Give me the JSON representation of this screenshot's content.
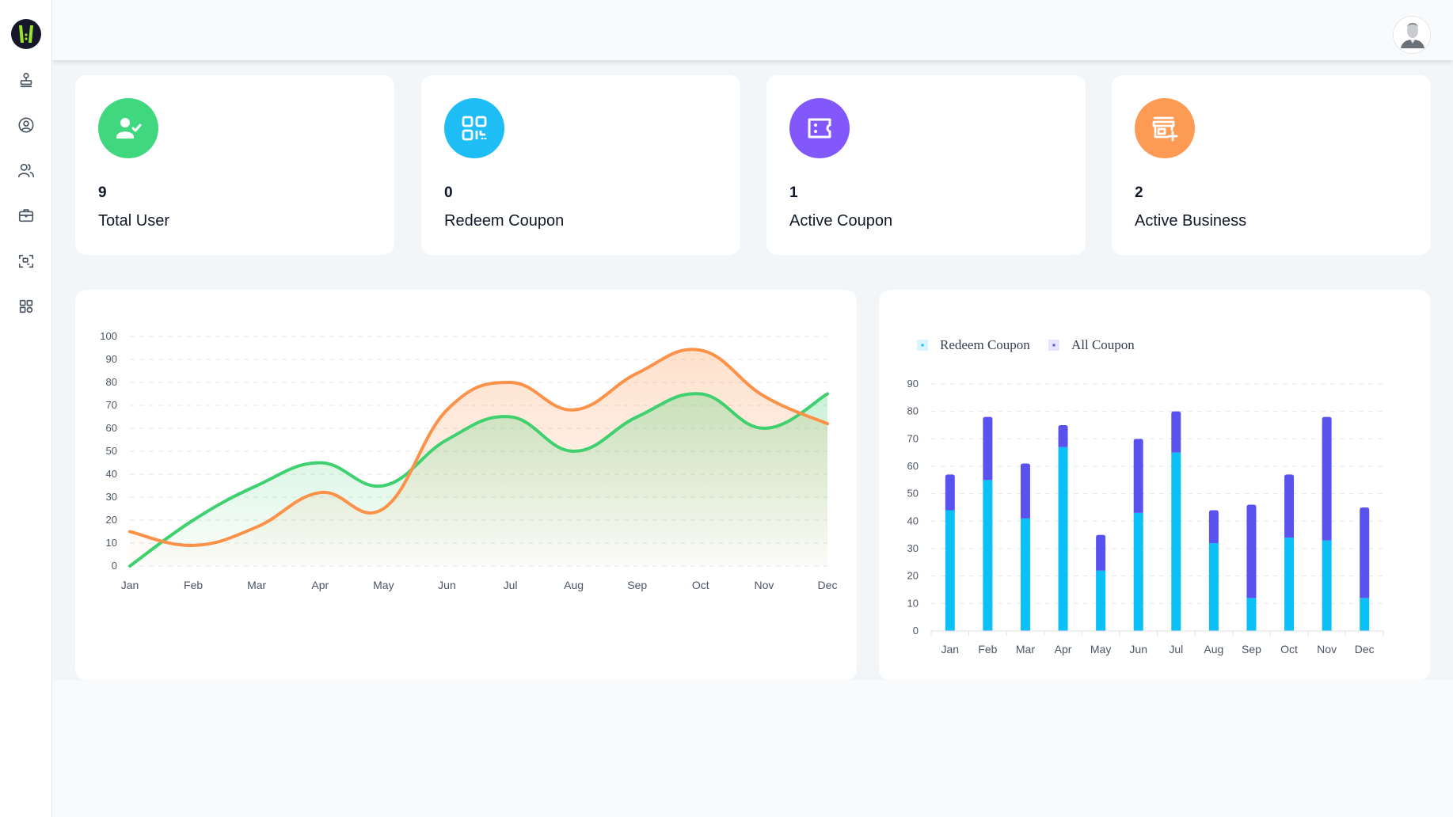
{
  "sidebar": {
    "logo": "app-logo",
    "items": [
      {
        "name": "stamp",
        "icon": "stamp-icon"
      },
      {
        "name": "profile",
        "icon": "user-circle-icon"
      },
      {
        "name": "users",
        "icon": "users-icon"
      },
      {
        "name": "business",
        "icon": "briefcase-icon"
      },
      {
        "name": "scan",
        "icon": "scan-icon"
      },
      {
        "name": "dashboard",
        "icon": "grid-icon"
      }
    ]
  },
  "header": {
    "avatar": "user-avatar"
  },
  "stats": [
    {
      "value": "9",
      "label": "Total User",
      "icon": "user-check-icon",
      "color": "#3fd87f"
    },
    {
      "value": "0",
      "label": "Redeem Coupon",
      "icon": "qr-code-icon",
      "color": "#1fbdf6"
    },
    {
      "value": "1",
      "label": "Active Coupon",
      "icon": "ticket-icon",
      "color": "#8257fb"
    },
    {
      "value": "2",
      "label": "Active Business",
      "icon": "store-add-icon",
      "color": "#fd9a53"
    }
  ],
  "chart_data": [
    {
      "type": "area",
      "title": "",
      "xlabel": "",
      "ylabel": "",
      "categories": [
        "Jan",
        "Feb",
        "Mar",
        "Apr",
        "May",
        "Jun",
        "Jul",
        "Aug",
        "Sep",
        "Oct",
        "Nov",
        "Dec"
      ],
      "yticks": [
        "0",
        "10",
        "20",
        "30",
        "40",
        "50",
        "60",
        "70",
        "80",
        "90",
        "100"
      ],
      "ylim": [
        0,
        100
      ],
      "grid": true,
      "legend": "none",
      "series": [
        {
          "name": "series-green",
          "color": "#3fd06f",
          "values": [
            0,
            20,
            35,
            45,
            35,
            55,
            65,
            50,
            65,
            75,
            60,
            75
          ]
        },
        {
          "name": "series-orange",
          "color": "#fb9248",
          "values": [
            15,
            9,
            17,
            32,
            25,
            68,
            80,
            68,
            84,
            94,
            74,
            62
          ]
        }
      ]
    },
    {
      "type": "bar",
      "stacked": true,
      "title": "",
      "xlabel": "",
      "ylabel": "",
      "categories": [
        "Jan",
        "Feb",
        "Mar",
        "Apr",
        "May",
        "Jun",
        "Jul",
        "Aug",
        "Sep",
        "Oct",
        "Nov",
        "Dec"
      ],
      "yticks": [
        "0",
        "10",
        "20",
        "30",
        "40",
        "50",
        "60",
        "70",
        "80",
        "90"
      ],
      "ylim": [
        0,
        90
      ],
      "grid": true,
      "legend": "top-left",
      "series": [
        {
          "name": "Redeem Coupon",
          "color": "#0bbff7",
          "values": [
            44,
            55,
            41,
            67,
            22,
            43,
            65,
            32,
            12,
            34,
            33,
            12
          ]
        },
        {
          "name": "All Coupon",
          "color": "#5a52ef",
          "values": [
            13,
            23,
            20,
            8,
            13,
            27,
            15,
            12,
            34,
            23,
            45,
            33
          ]
        }
      ]
    }
  ]
}
